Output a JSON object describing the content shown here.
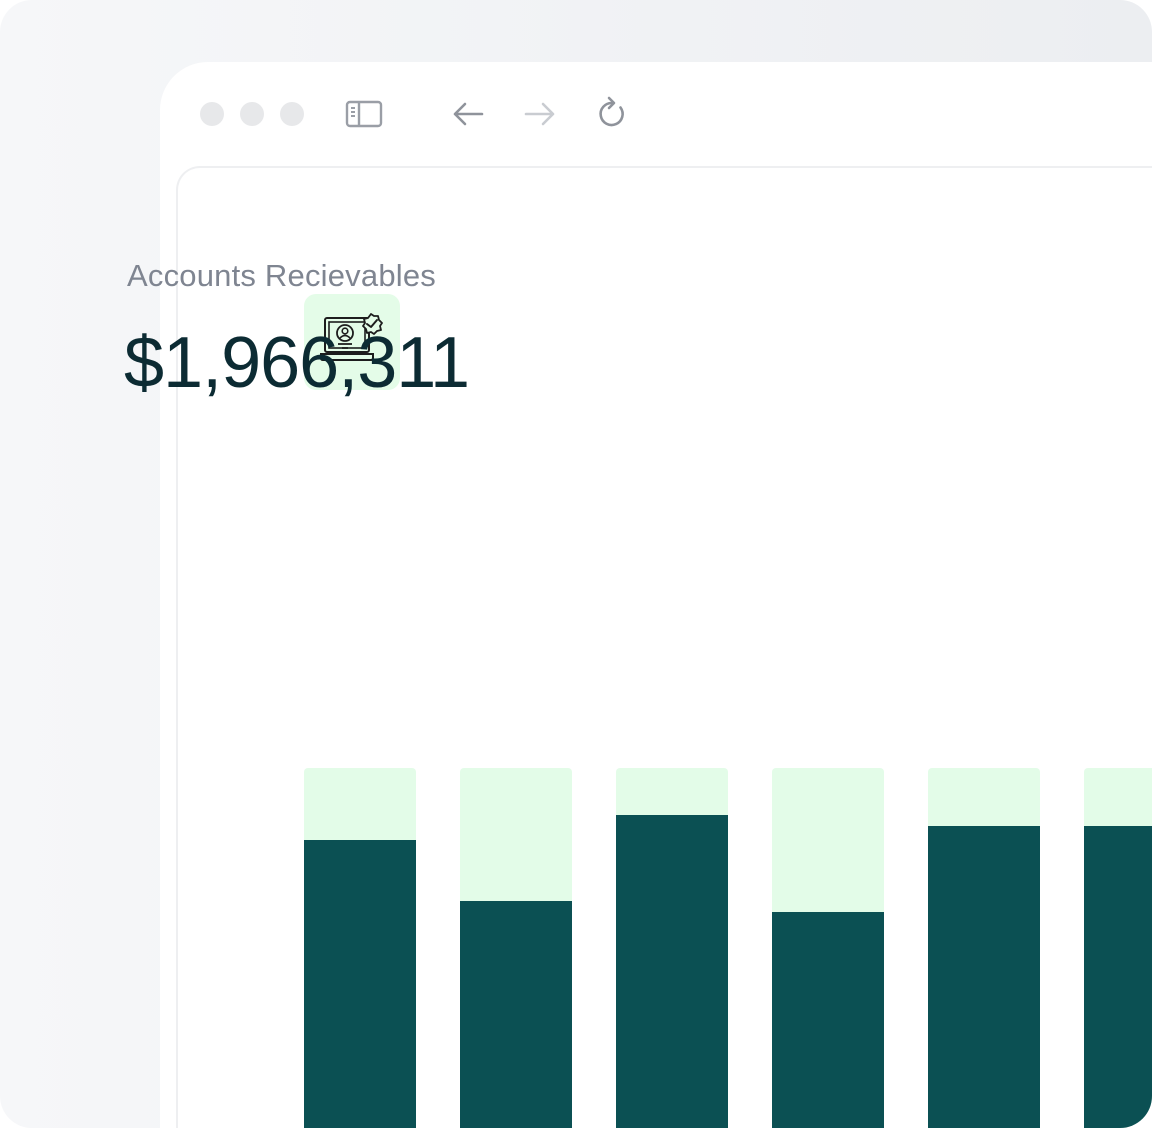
{
  "metric": {
    "label": "Accounts Recievables",
    "value": "$1,966,311"
  },
  "toolbar": {
    "icons": [
      "sidebar-toggle-icon",
      "back-arrow-icon",
      "forward-arrow-icon",
      "reload-icon"
    ]
  },
  "chart_data": {
    "type": "bar",
    "stacked": true,
    "categories": [
      "",
      "",
      "",
      "",
      "",
      ""
    ],
    "series": [
      {
        "values": [
          0.8,
          0.63,
          0.87,
          0.6,
          0.84,
          0.84
        ]
      }
    ],
    "ylim": [
      0,
      1
    ],
    "colors": {
      "fill": "#0b5053",
      "track": "#e3fce8"
    }
  },
  "colors": {
    "badge_background": "#e4fce8",
    "value_text": "#0c2b33",
    "label_text": "#7f8591"
  }
}
